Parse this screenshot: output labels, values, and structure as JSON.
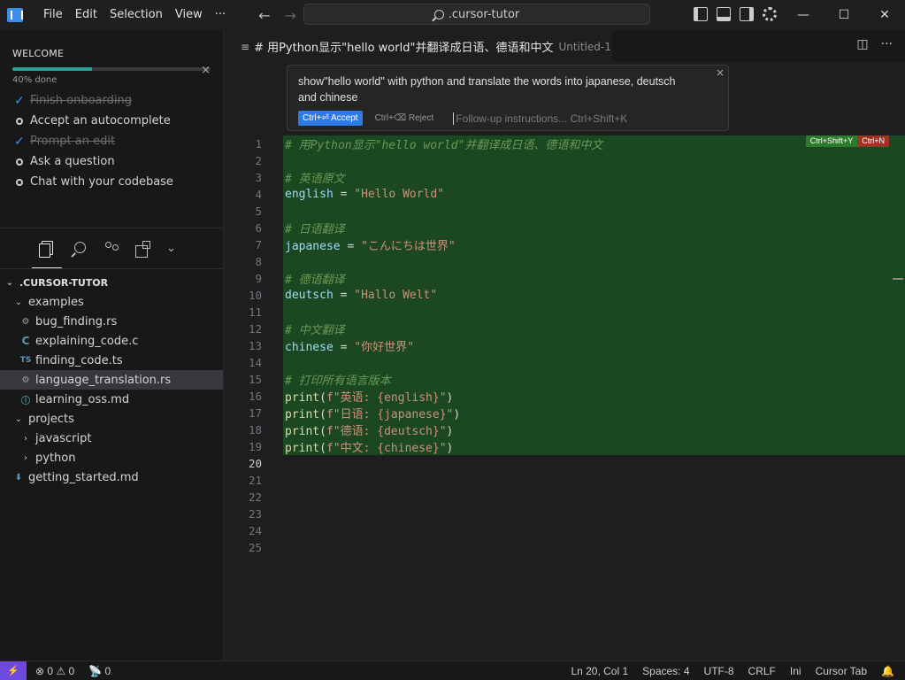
{
  "menu": [
    "File",
    "Edit",
    "Selection",
    "View",
    "···"
  ],
  "nav": {
    "back": "←",
    "forward": "→"
  },
  "search": {
    "text": ".cursor-tutor"
  },
  "window_controls": {
    "minimize": "—",
    "maximize": "☐",
    "close": "✕"
  },
  "welcome": {
    "title": "WELCOME",
    "close": "×",
    "progress_text": "40% done",
    "progress_fraction": 0.4,
    "items": [
      {
        "label": "Finish onboarding",
        "done": true
      },
      {
        "label": "Accept an autocomplete",
        "done": false
      },
      {
        "label": "Prompt an edit",
        "done": true
      },
      {
        "label": "Ask a question",
        "done": false
      },
      {
        "label": "Chat with your codebase",
        "done": false
      }
    ]
  },
  "explorer": {
    "root": ".CURSOR-TUTOR",
    "examples_folder": "examples",
    "examples_files": [
      {
        "name": "bug_finding.rs",
        "icon": "rust-icon",
        "glyph": "⚙"
      },
      {
        "name": "explaining_code.c",
        "icon": "c-icon",
        "glyph": "C"
      },
      {
        "name": "finding_code.ts",
        "icon": "typescript-icon",
        "glyph": "TS"
      },
      {
        "name": "language_translation.rs",
        "icon": "rust-icon",
        "glyph": "⚙"
      },
      {
        "name": "learning_oss.md",
        "icon": "markdown-icon",
        "glyph": "ⓘ"
      }
    ],
    "projects_folder": "projects",
    "project_subfolders": [
      "javascript",
      "python"
    ],
    "root_file": {
      "name": "getting_started.md",
      "icon": "markdown-download-icon",
      "glyph": "⬇"
    }
  },
  "tab": {
    "title": "# 用Python显示\"hello world\"并翻译成日语、德语和中文",
    "description": "Untitled-1"
  },
  "prompt": {
    "text": "show\"hello world\" with python and translate the words into japanese, deutsch and chinese",
    "accept": "Ctrl+⏎ Accept",
    "reject": "Ctrl+⌫ Reject",
    "followup_placeholder": "Follow-up instructions... Ctrl+Shift+K",
    "close": "×"
  },
  "hint_keys": {
    "accept": "Ctrl+Shift+Y",
    "reject": "Ctrl+N"
  },
  "code_lines": [
    {
      "n": "1",
      "text": "# 用Python显示\"hello world\"并翻译成日语、德语和中文",
      "kind": "comment",
      "added": true
    },
    {
      "n": "2",
      "text": "",
      "kind": "blank",
      "added": true
    },
    {
      "n": "3",
      "text": "# 英语原文",
      "kind": "comment",
      "added": true
    },
    {
      "n": "4",
      "var": "english",
      "value": "\"Hello World\"",
      "kind": "assign",
      "added": true
    },
    {
      "n": "5",
      "text": "",
      "kind": "blank",
      "added": true
    },
    {
      "n": "6",
      "text": "# 日语翻译",
      "kind": "comment",
      "added": true
    },
    {
      "n": "7",
      "var": "japanese",
      "value": "\"こんにちは世界\"",
      "kind": "assign",
      "added": true
    },
    {
      "n": "8",
      "text": "",
      "kind": "blank",
      "added": true
    },
    {
      "n": "9",
      "text": "# 德语翻译",
      "kind": "comment",
      "added": true
    },
    {
      "n": "10",
      "var": "deutsch",
      "value": "\"Hallo Welt\"",
      "kind": "assign",
      "added": true
    },
    {
      "n": "11",
      "text": "",
      "kind": "blank",
      "added": true
    },
    {
      "n": "12",
      "text": "# 中文翻译",
      "kind": "comment",
      "added": true
    },
    {
      "n": "13",
      "var": "chinese",
      "value": "\"你好世界\"",
      "kind": "assign",
      "added": true
    },
    {
      "n": "14",
      "text": "",
      "kind": "blank",
      "added": true
    },
    {
      "n": "15",
      "text": "# 打印所有语言版本",
      "kind": "comment",
      "added": true
    },
    {
      "n": "16",
      "fstr": "f\"英语: {english}\"",
      "kind": "print",
      "added": true
    },
    {
      "n": "17",
      "fstr": "f\"日语: {japanese}\"",
      "kind": "print",
      "added": true
    },
    {
      "n": "18",
      "fstr": "f\"德语: {deutsch}\"",
      "kind": "print",
      "added": true
    },
    {
      "n": "19",
      "fstr": "f\"中文: {chinese}\"",
      "kind": "print",
      "added": true
    },
    {
      "n": "20",
      "text": "",
      "kind": "blank",
      "added": false,
      "current": true
    },
    {
      "n": "21",
      "text": "",
      "kind": "blank",
      "added": false
    },
    {
      "n": "22",
      "text": "",
      "kind": "blank",
      "added": false
    },
    {
      "n": "23",
      "text": "",
      "kind": "blank",
      "added": false
    },
    {
      "n": "24",
      "text": "",
      "kind": "blank",
      "added": false
    },
    {
      "n": "25",
      "text": "",
      "kind": "blank",
      "added": false
    }
  ],
  "status": {
    "remote": "⚡",
    "problems": "⊗ 0 ⚠ 0",
    "ports": "📡 0",
    "position": "Ln 20, Col 1",
    "spaces": "Spaces: 4",
    "encoding": "UTF-8",
    "eol": "CRLF",
    "language": "Ini",
    "cursor_tab": "Cursor Tab",
    "bell": "🔔"
  },
  "colors": {
    "accent": "#3794ff",
    "added_bg": "#1b4721",
    "remote_bg": "#6f48e0"
  }
}
